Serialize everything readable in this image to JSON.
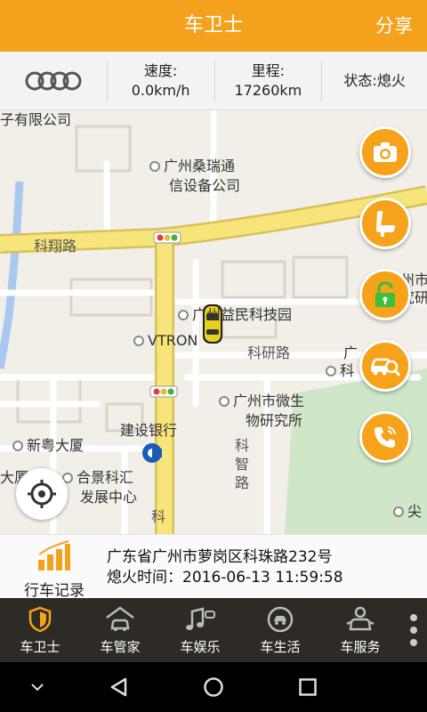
{
  "header": {
    "title": "车卫士",
    "share_label": "分享"
  },
  "status": {
    "brand_icon": "audi-rings-logo",
    "speed_label": "速度:",
    "speed_value": "0.0km/h",
    "mileage_label": "里程:",
    "mileage_value": "17260km",
    "state_text": "状态:熄火"
  },
  "map": {
    "labels": {
      "company_top": "子有限公司",
      "sangrui_1": "广州桑瑞通",
      "sangrui_2": "信设备公司",
      "kexiang_road": "科翔路",
      "guangzhou_shi_1": "州市",
      "guangzhou_shi_2": "究研",
      "yimin": "广州益民科技园",
      "vtron": "VTRON",
      "keyan_road": "科研路",
      "guang_ke_1": "广",
      "guang_ke_2": "科",
      "microbe_1": "广州市微生",
      "microbe_2": "物研究所",
      "ccb": "建设银行",
      "xinyue": "新粤大厦",
      "da": "大厦",
      "hejing_1": "合景科汇",
      "hejing_2": "发展中心",
      "kezhi_road": "科智路",
      "ke_bottom": "科",
      "jian": "尖"
    },
    "buttons": [
      "camera-icon",
      "seat-icon",
      "lock-icon",
      "car-search-icon",
      "phone-icon"
    ]
  },
  "address": {
    "record_label": "行车记录",
    "location": "广东省广州市萝岗区科珠路232号",
    "off_time": "熄火时间：2016-06-13 11:59:58"
  },
  "tabs": [
    {
      "label": "车卫士",
      "icon": "shield-icon",
      "active": true
    },
    {
      "label": "车管家",
      "icon": "garage-icon",
      "active": false
    },
    {
      "label": "车娱乐",
      "icon": "music-icon",
      "active": false
    },
    {
      "label": "车生活",
      "icon": "life-icon",
      "active": false
    },
    {
      "label": "车服务",
      "icon": "service-icon",
      "active": false
    }
  ],
  "colors": {
    "accent": "#f4a21e",
    "tabbar": "#2e2a25",
    "road_major": "#f7e57a"
  }
}
